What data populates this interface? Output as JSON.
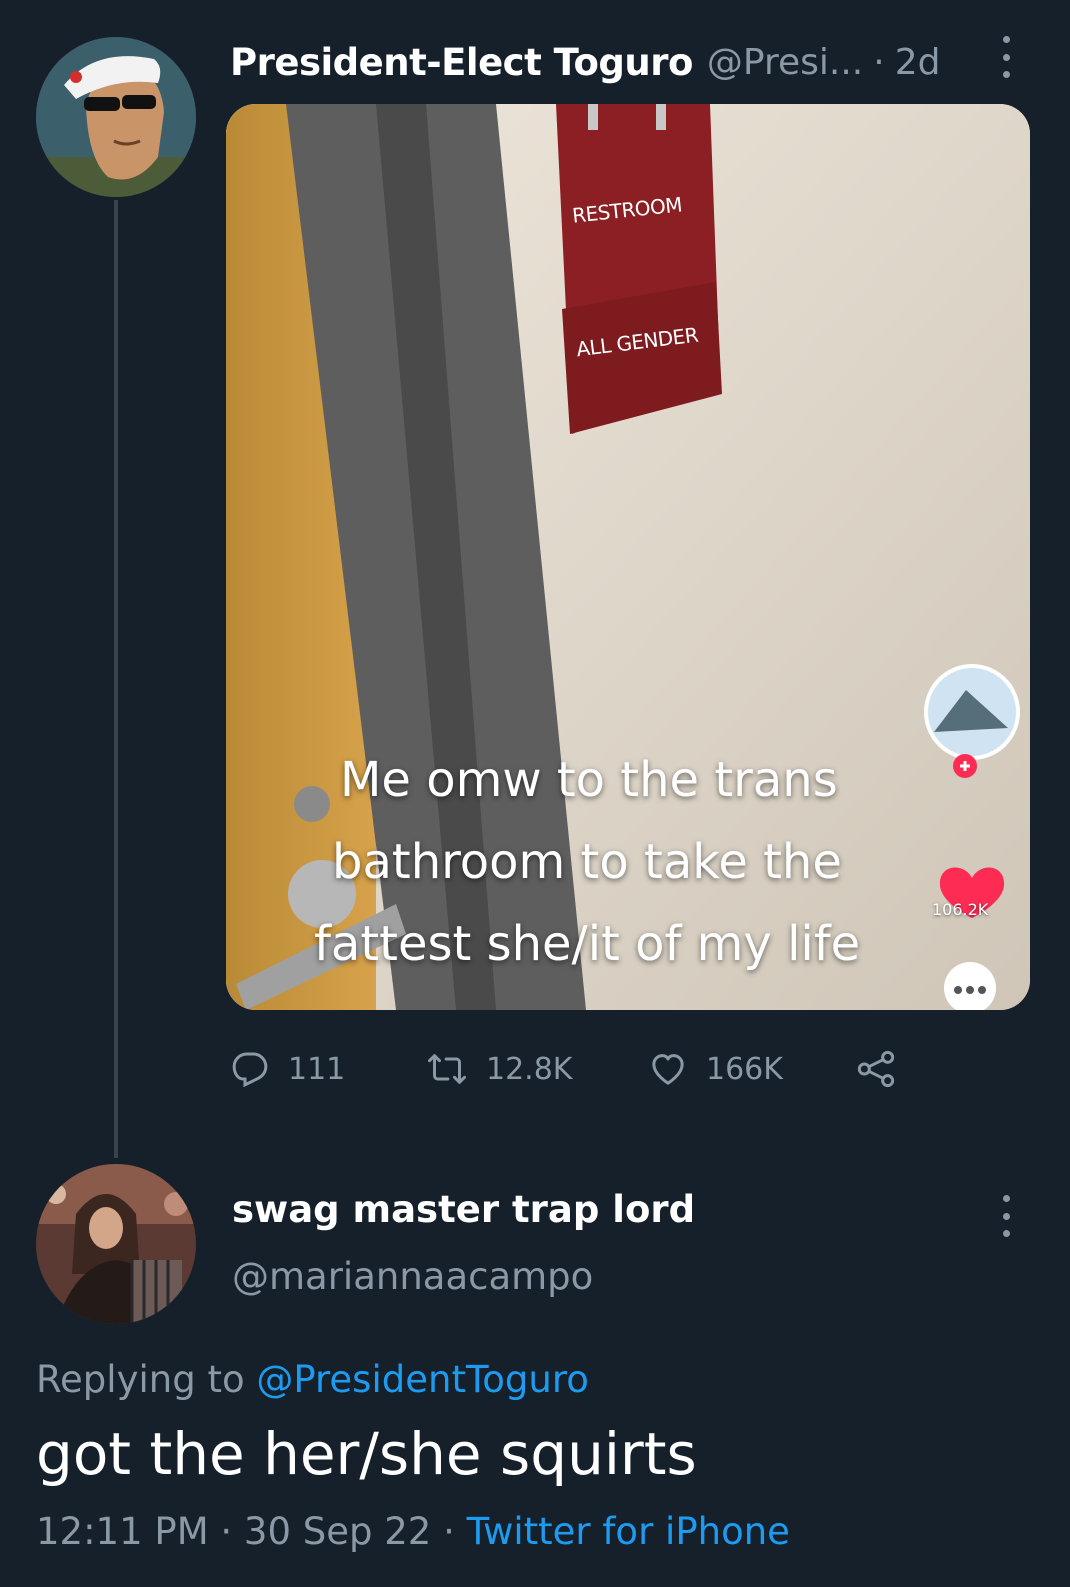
{
  "tweet": {
    "display_name": "President-Elect Toguro",
    "handle": "@Presi...",
    "separator": "·",
    "time": "2d",
    "media": {
      "sign_top": "RESTROOM",
      "sign_bottom": "ALL GENDER",
      "caption_lines": [
        "Me omw to the trans",
        "bathroom to take the",
        "fattest she/it of my life"
      ],
      "like_count": "106.2K"
    },
    "stats": {
      "replies": "111",
      "retweets": "12.8K",
      "likes": "166K"
    }
  },
  "reply": {
    "display_name": "swag master trap lord",
    "handle": "@mariannaacampo",
    "replying_prefix": "Replying to ",
    "replying_to": "@PresidentToguro",
    "text": "got the her/she squirts",
    "time": "12:11 PM",
    "date": "30 Sep 22",
    "separator": "·",
    "source": "Twitter for iPhone"
  },
  "colors": {
    "background": "#15202b",
    "secondary_text": "#8b98a5",
    "link": "#1d9bf0",
    "tiktok_red": "#fe2c55"
  }
}
